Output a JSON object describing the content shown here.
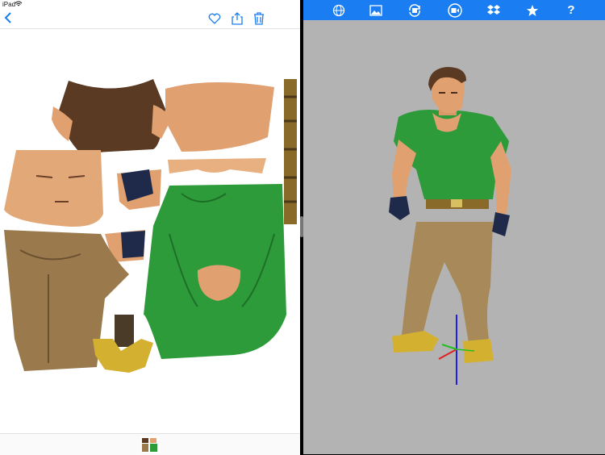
{
  "status_bar": {
    "carrier": "iPad"
  },
  "left_pane": {
    "nav": {
      "back_icon": "chevron-left-icon",
      "actions": [
        "heart-icon",
        "share-icon",
        "trash-icon"
      ]
    },
    "content": "texture-atlas",
    "bottom": {
      "thumbnail": "texture-thumbnail"
    }
  },
  "right_pane": {
    "toolbar": {
      "icons": [
        "globe-icon",
        "image-icon",
        "rotate-icon",
        "video-record-icon",
        "dropbox-icon",
        "star-icon",
        "help-icon"
      ],
      "help_label": "?"
    },
    "viewport": {
      "background": "#b3b3b3",
      "model": "character-3d-model",
      "axis_gizmo_colors": [
        "#e02020",
        "#20c020",
        "#2020e0"
      ]
    }
  },
  "colors": {
    "accent": "#1a7df2",
    "shirt": "#2e9b3a",
    "pants": "#9a7a4c",
    "skin": "#e0a070",
    "hair": "#5a3a22"
  }
}
